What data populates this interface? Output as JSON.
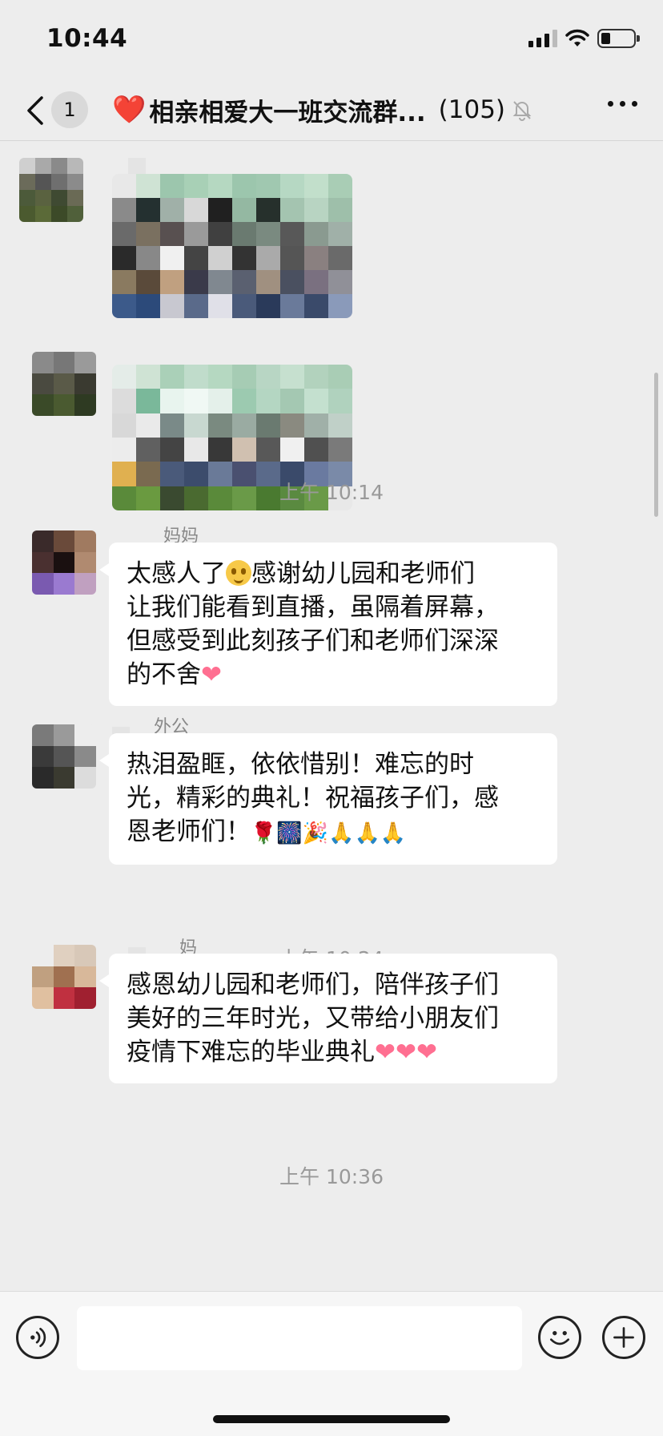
{
  "status": {
    "time": "10:44",
    "battery_fraction": 0.3
  },
  "nav": {
    "unread_count": "1",
    "title": "相亲相爱大一班交流群...",
    "member_count": "(105)",
    "title_heart": "❤️"
  },
  "messages": [
    {
      "type": "image",
      "sender": ""
    },
    {
      "type": "image",
      "sender": ""
    },
    {
      "type": "time",
      "text": "上午 10:14"
    },
    {
      "type": "text",
      "sender": "妈妈",
      "text": "太感人了🙂感谢幼儿园和老师们让我们能看到直播，虽隔着屏幕，但感受到此刻孩子们和老师们深深的不舍❤️"
    },
    {
      "type": "text",
      "sender": "外公",
      "text": "热泪盈眶，依依惜别！难忘的时光，精彩的典礼！祝福孩子们，感恩老师们！🌹🎆🎉🙏🙏🙏"
    },
    {
      "type": "time",
      "text": "上午 10:24"
    },
    {
      "type": "text",
      "sender": "妈",
      "text": "感恩幼儿园和老师们，陪伴孩子们美好的三年时光，又带给小朋友们疫情下难忘的毕业典礼❤️❤️❤️"
    },
    {
      "type": "time",
      "text": "上午 10:36"
    }
  ],
  "bubble_parts": {
    "m3_a": "太感人了",
    "m3_b": "感谢幼儿园和老师们",
    "m3_c": "让我们能看到直播，虽隔着屏幕，",
    "m3_d": "但感受到此刻孩子们和老师们深深",
    "m3_e": "的不舍",
    "m4_a": "热泪盈眶，依依惜别！难忘的时",
    "m4_b": "光，精彩的典礼！祝福孩子们，感",
    "m4_c": "恩老师们！",
    "m4_emoji": "🌹🎆🎉🙏🙏🙏",
    "m6_a": "感恩幼儿园和老师们，陪伴孩子们",
    "m6_b": "美好的三年时光，又带给小朋友们",
    "m6_c": "疫情下难忘的毕业典礼"
  },
  "emojis": {
    "heart": "❤",
    "hearts3": "❤❤❤"
  },
  "input": {
    "placeholder": "",
    "value": ""
  },
  "icons": [
    "back-chevron-icon",
    "mute-bell-icon",
    "more-dots-icon",
    "voice-icon",
    "emoji-face-icon",
    "plus-icon"
  ],
  "colors": {
    "bg": "#ededed",
    "bubble": "#ffffff",
    "time": "#999999",
    "heart": "#e0242f"
  }
}
